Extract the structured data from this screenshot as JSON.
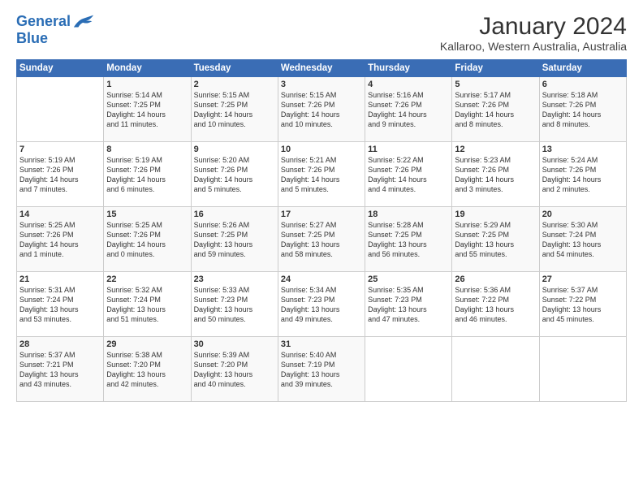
{
  "header": {
    "logo_line1": "General",
    "logo_line2": "Blue",
    "title": "January 2024",
    "subtitle": "Kallaroo, Western Australia, Australia"
  },
  "days_of_week": [
    "Sunday",
    "Monday",
    "Tuesday",
    "Wednesday",
    "Thursday",
    "Friday",
    "Saturday"
  ],
  "weeks": [
    [
      {
        "day": "",
        "content": ""
      },
      {
        "day": "1",
        "content": "Sunrise: 5:14 AM\nSunset: 7:25 PM\nDaylight: 14 hours\nand 11 minutes."
      },
      {
        "day": "2",
        "content": "Sunrise: 5:15 AM\nSunset: 7:25 PM\nDaylight: 14 hours\nand 10 minutes."
      },
      {
        "day": "3",
        "content": "Sunrise: 5:15 AM\nSunset: 7:26 PM\nDaylight: 14 hours\nand 10 minutes."
      },
      {
        "day": "4",
        "content": "Sunrise: 5:16 AM\nSunset: 7:26 PM\nDaylight: 14 hours\nand 9 minutes."
      },
      {
        "day": "5",
        "content": "Sunrise: 5:17 AM\nSunset: 7:26 PM\nDaylight: 14 hours\nand 8 minutes."
      },
      {
        "day": "6",
        "content": "Sunrise: 5:18 AM\nSunset: 7:26 PM\nDaylight: 14 hours\nand 8 minutes."
      }
    ],
    [
      {
        "day": "7",
        "content": "Sunrise: 5:19 AM\nSunset: 7:26 PM\nDaylight: 14 hours\nand 7 minutes."
      },
      {
        "day": "8",
        "content": "Sunrise: 5:19 AM\nSunset: 7:26 PM\nDaylight: 14 hours\nand 6 minutes."
      },
      {
        "day": "9",
        "content": "Sunrise: 5:20 AM\nSunset: 7:26 PM\nDaylight: 14 hours\nand 5 minutes."
      },
      {
        "day": "10",
        "content": "Sunrise: 5:21 AM\nSunset: 7:26 PM\nDaylight: 14 hours\nand 5 minutes."
      },
      {
        "day": "11",
        "content": "Sunrise: 5:22 AM\nSunset: 7:26 PM\nDaylight: 14 hours\nand 4 minutes."
      },
      {
        "day": "12",
        "content": "Sunrise: 5:23 AM\nSunset: 7:26 PM\nDaylight: 14 hours\nand 3 minutes."
      },
      {
        "day": "13",
        "content": "Sunrise: 5:24 AM\nSunset: 7:26 PM\nDaylight: 14 hours\nand 2 minutes."
      }
    ],
    [
      {
        "day": "14",
        "content": "Sunrise: 5:25 AM\nSunset: 7:26 PM\nDaylight: 14 hours\nand 1 minute."
      },
      {
        "day": "15",
        "content": "Sunrise: 5:25 AM\nSunset: 7:26 PM\nDaylight: 14 hours\nand 0 minutes."
      },
      {
        "day": "16",
        "content": "Sunrise: 5:26 AM\nSunset: 7:25 PM\nDaylight: 13 hours\nand 59 minutes."
      },
      {
        "day": "17",
        "content": "Sunrise: 5:27 AM\nSunset: 7:25 PM\nDaylight: 13 hours\nand 58 minutes."
      },
      {
        "day": "18",
        "content": "Sunrise: 5:28 AM\nSunset: 7:25 PM\nDaylight: 13 hours\nand 56 minutes."
      },
      {
        "day": "19",
        "content": "Sunrise: 5:29 AM\nSunset: 7:25 PM\nDaylight: 13 hours\nand 55 minutes."
      },
      {
        "day": "20",
        "content": "Sunrise: 5:30 AM\nSunset: 7:24 PM\nDaylight: 13 hours\nand 54 minutes."
      }
    ],
    [
      {
        "day": "21",
        "content": "Sunrise: 5:31 AM\nSunset: 7:24 PM\nDaylight: 13 hours\nand 53 minutes."
      },
      {
        "day": "22",
        "content": "Sunrise: 5:32 AM\nSunset: 7:24 PM\nDaylight: 13 hours\nand 51 minutes."
      },
      {
        "day": "23",
        "content": "Sunrise: 5:33 AM\nSunset: 7:23 PM\nDaylight: 13 hours\nand 50 minutes."
      },
      {
        "day": "24",
        "content": "Sunrise: 5:34 AM\nSunset: 7:23 PM\nDaylight: 13 hours\nand 49 minutes."
      },
      {
        "day": "25",
        "content": "Sunrise: 5:35 AM\nSunset: 7:23 PM\nDaylight: 13 hours\nand 47 minutes."
      },
      {
        "day": "26",
        "content": "Sunrise: 5:36 AM\nSunset: 7:22 PM\nDaylight: 13 hours\nand 46 minutes."
      },
      {
        "day": "27",
        "content": "Sunrise: 5:37 AM\nSunset: 7:22 PM\nDaylight: 13 hours\nand 45 minutes."
      }
    ],
    [
      {
        "day": "28",
        "content": "Sunrise: 5:37 AM\nSunset: 7:21 PM\nDaylight: 13 hours\nand 43 minutes."
      },
      {
        "day": "29",
        "content": "Sunrise: 5:38 AM\nSunset: 7:20 PM\nDaylight: 13 hours\nand 42 minutes."
      },
      {
        "day": "30",
        "content": "Sunrise: 5:39 AM\nSunset: 7:20 PM\nDaylight: 13 hours\nand 40 minutes."
      },
      {
        "day": "31",
        "content": "Sunrise: 5:40 AM\nSunset: 7:19 PM\nDaylight: 13 hours\nand 39 minutes."
      },
      {
        "day": "",
        "content": ""
      },
      {
        "day": "",
        "content": ""
      },
      {
        "day": "",
        "content": ""
      }
    ]
  ]
}
